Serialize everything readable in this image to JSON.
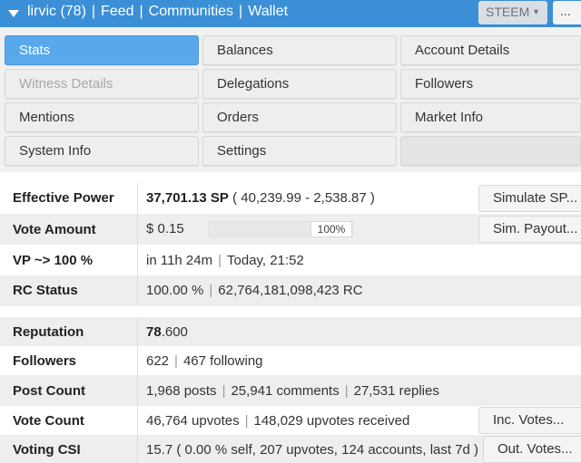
{
  "topbar": {
    "account": "lirvic (78)",
    "links": [
      "Feed",
      "Communities",
      "Wallet"
    ],
    "separator": "|",
    "chain_selected": "STEEM",
    "more_label": "..."
  },
  "menu": {
    "stats": "Stats",
    "balances": "Balances",
    "account_details": "Account Details",
    "witness_details": "Witness Details",
    "delegations": "Delegations",
    "followers": "Followers",
    "mentions": "Mentions",
    "orders": "Orders",
    "market_info": "Market Info",
    "system_info": "System Info",
    "settings": "Settings"
  },
  "stats": {
    "effective_power": {
      "label": "Effective Power",
      "value": "37,701.13 SP",
      "detail": "( 40,239.99 - 2,538.87 )",
      "button": "Simulate SP..."
    },
    "vote_amount": {
      "label": "Vote Amount",
      "value": "$ 0.15",
      "percent": "100%",
      "fill_fraction": 1.0,
      "button": "Sim. Payout..."
    },
    "vp": {
      "label": "VP ~> 100 %",
      "value": "in 11h 24m",
      "detail": "Today, 21:52"
    },
    "rc_status": {
      "label": "RC Status",
      "value": "100.00 %",
      "detail": "62,764,181,098,423 RC"
    },
    "reputation": {
      "label": "Reputation",
      "value_int": "78",
      "value_dec": ".600"
    },
    "followers": {
      "label": "Followers",
      "value": "622",
      "detail": "467 following"
    },
    "post_count": {
      "label": "Post Count",
      "posts": "1,968 posts",
      "comments": "25,941 comments",
      "replies": "27,531 replies"
    },
    "vote_count": {
      "label": "Vote Count",
      "value": "46,764 upvotes",
      "detail": "148,029 upvotes received",
      "button": "Inc. Votes..."
    },
    "voting_csi": {
      "label": "Voting CSI",
      "value": "15.7 ( 0.00 % self, 207 upvotes, 124 accounts, last 7d )",
      "button": "Out. Votes..."
    }
  }
}
